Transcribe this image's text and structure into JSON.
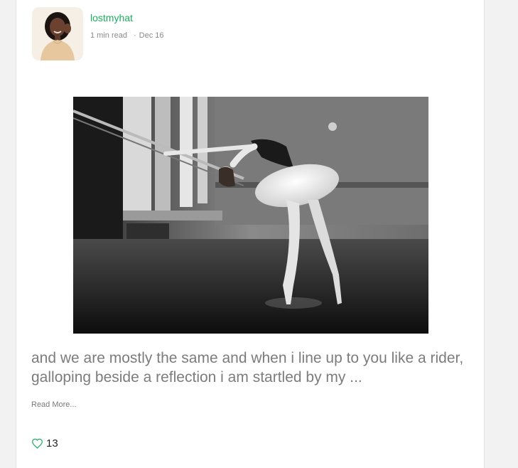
{
  "post": {
    "author": {
      "name": "lostmyhat",
      "avatar_icon": "author-avatar"
    },
    "read_time": "1 min read",
    "separator": "·",
    "date": "Dec 16",
    "hero_image_icon": "ballerina-photo",
    "excerpt": "and we are mostly the same and when i line up to you like a rider, galloping beside a reflection i am startled by my ...",
    "read_more_label": "Read More...",
    "likes": {
      "icon": "heart-outline-icon",
      "count": "13",
      "color": "#1aaf5d"
    }
  },
  "colors": {
    "accent": "#1aaf5d",
    "text_muted": "#7c7c7c",
    "background": "#f2f2f2",
    "card": "#ffffff"
  }
}
